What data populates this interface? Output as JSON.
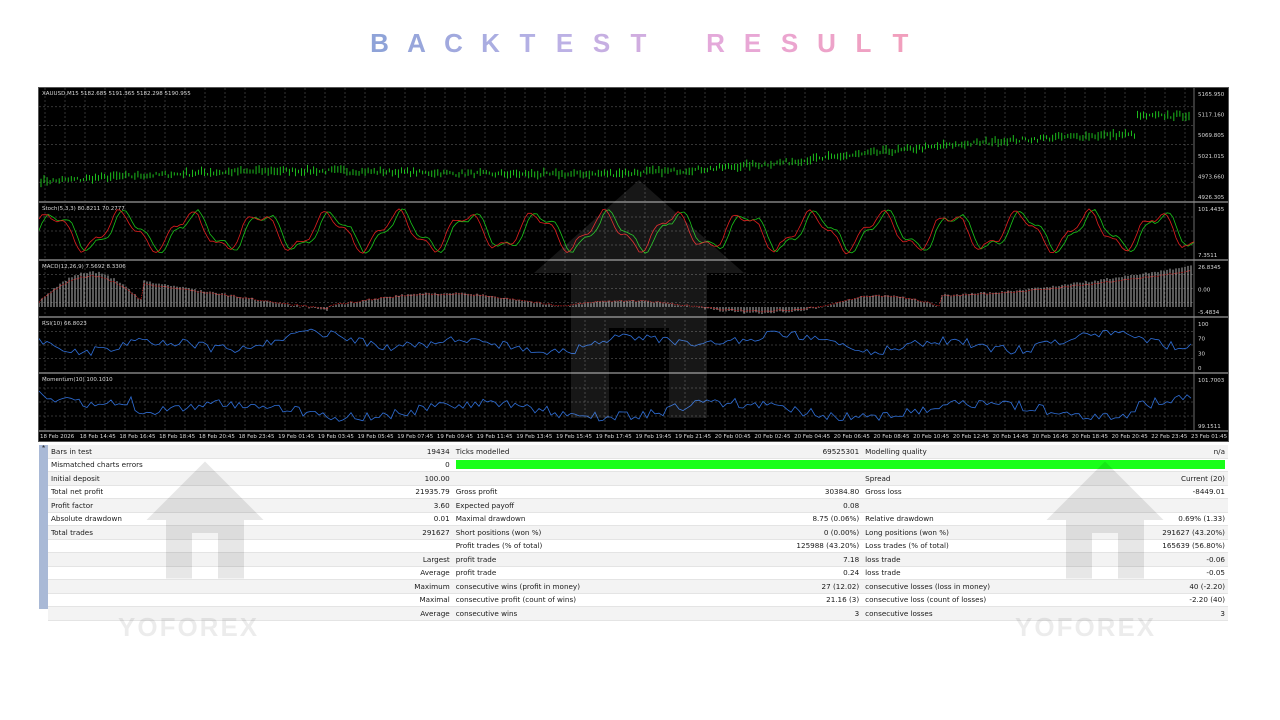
{
  "title": "BACKTEST RESULT",
  "title_gradient": [
    "#8fa3d8",
    "#b9b2e6",
    "#e7a8d9",
    "#f19fbd"
  ],
  "watermark_text": "YOFOREX",
  "chart": {
    "main_label": "XAUUSD,M15  5182.685 5191.365 5182.298 5190.955",
    "main_ticks": [
      "5165.950",
      "5117.160",
      "5069.805",
      "5021.015",
      "4973.660",
      "4926.305"
    ],
    "stoch_label": "Stoch(5,3,3) 80.8211 70.2777",
    "stoch_ticks": [
      "101.4435",
      "7.3511"
    ],
    "macd_label": "MACD(12,26,9) 7.5692 8.3306",
    "macd_ticks": [
      "26.8345",
      "0.00",
      "-5.4834"
    ],
    "rsi_label": "RSI(10) 66.8023",
    "rsi_ticks": [
      "100",
      "70",
      "30",
      "0"
    ],
    "mom_label": "Momentum(10) 100.1010",
    "mom_ticks": [
      "101.7003",
      "99.1511"
    ],
    "time_labels": [
      "18 Feb 2026",
      "18 Feb 14:45",
      "18 Feb 16:45",
      "18 Feb 18:45",
      "18 Feb 20:45",
      "18 Feb 23:45",
      "19 Feb 01:45",
      "19 Feb 03:45",
      "19 Feb 05:45",
      "19 Feb 07:45",
      "19 Feb 09:45",
      "19 Feb 11:45",
      "19 Feb 13:45",
      "19 Feb 15:45",
      "19 Feb 17:45",
      "19 Feb 19:45",
      "19 Feb 21:45",
      "20 Feb 00:45",
      "20 Feb 02:45",
      "20 Feb 04:45",
      "20 Feb 06:45",
      "20 Feb 08:45",
      "20 Feb 10:45",
      "20 Feb 12:45",
      "20 Feb 14:45",
      "20 Feb 16:45",
      "20 Feb 18:45",
      "20 Feb 20:45",
      "22 Feb 23:45",
      "23 Feb 01:45"
    ],
    "colors": {
      "price": "#1fd11f",
      "stoch_main": "#19c419",
      "stoch_signal": "#e01e1e",
      "macd_hist": "#c8c8c8",
      "macd_signal": "#d02020",
      "rsi": "#2f6fd8",
      "momentum": "#2f6fd8",
      "grid": "#6b6b6b"
    }
  },
  "report": {
    "quality_bar_color": "#19ff19",
    "rows": [
      [
        "Bars in test",
        "19434",
        "Ticks modelled",
        "69525301",
        "Modelling quality",
        "n/a"
      ],
      [
        "Mismatched charts errors",
        "0",
        "",
        "",
        "",
        ""
      ],
      [
        "Initial deposit",
        "100.00",
        "",
        "",
        "Spread",
        "Current (20)"
      ],
      [
        "Total net profit",
        "21935.79",
        "Gross profit",
        "30384.80",
        "Gross loss",
        "-8449.01"
      ],
      [
        "Profit factor",
        "3.60",
        "Expected payoff",
        "0.08",
        "",
        ""
      ],
      [
        "Absolute drawdown",
        "0.01",
        "Maximal drawdown",
        "8.75 (0.06%)",
        "Relative drawdown",
        "0.69% (1.33)"
      ],
      [
        "Total trades",
        "291627",
        "Short positions (won %)",
        "0 (0.00%)",
        "Long positions (won %)",
        "291627 (43.20%)"
      ],
      [
        "",
        "",
        "Profit trades (% of total)",
        "125988 (43.20%)",
        "Loss trades (% of total)",
        "165639 (56.80%)"
      ],
      [
        "",
        "Largest",
        "profit trade",
        "7.18",
        "loss trade",
        "-0.06"
      ],
      [
        "",
        "Average",
        "profit trade",
        "0.24",
        "loss trade",
        "-0.05"
      ],
      [
        "",
        "Maximum",
        "consecutive wins (profit in money)",
        "27 (12.02)",
        "consecutive losses (loss in money)",
        "40 (-2.20)"
      ],
      [
        "",
        "Maximal",
        "consecutive profit (count of wins)",
        "21.16 (3)",
        "consecutive loss (count of losses)",
        "-2.20 (40)"
      ],
      [
        "",
        "Average",
        "consecutive wins",
        "3",
        "consecutive losses",
        "3"
      ]
    ]
  }
}
